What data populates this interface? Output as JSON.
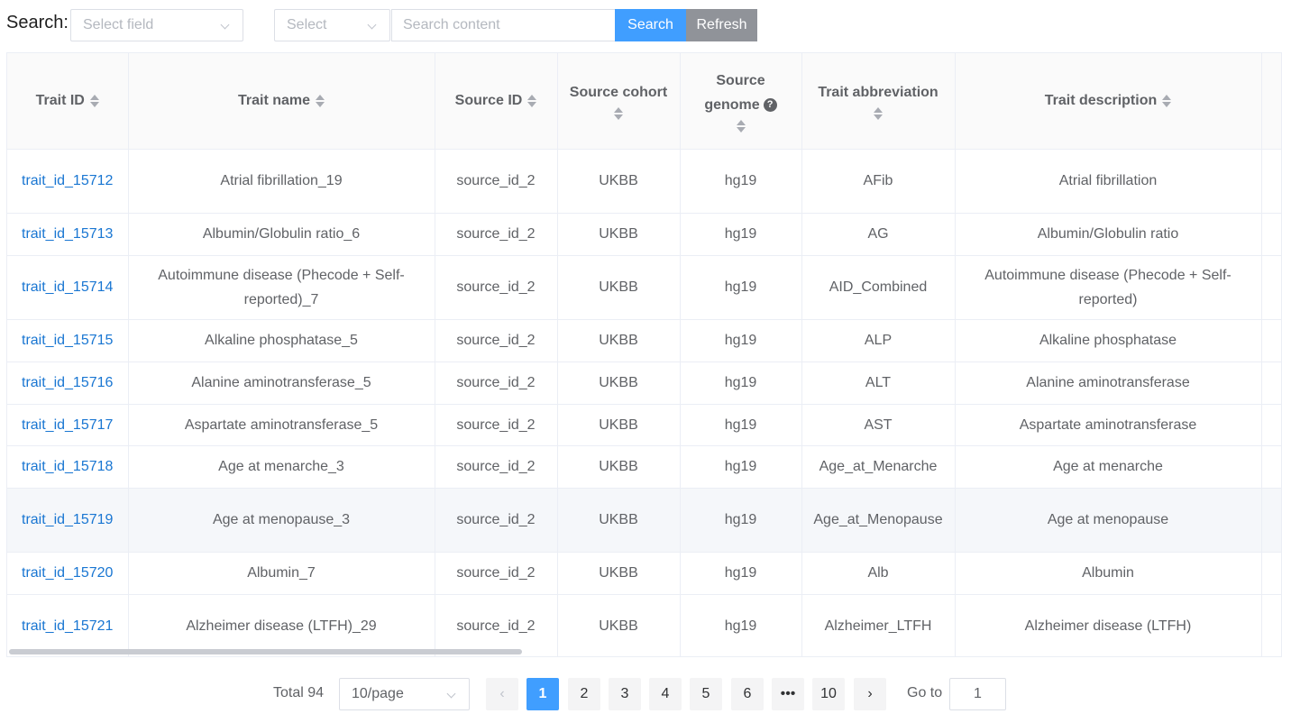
{
  "search": {
    "label": "Search:",
    "field_placeholder": "Select field",
    "operator_placeholder": "Select",
    "content_placeholder": "Search content",
    "search_button": "Search",
    "refresh_button": "Refresh"
  },
  "table": {
    "columns": [
      {
        "label": "Trait ID"
      },
      {
        "label": "Trait name"
      },
      {
        "label": "Source ID"
      },
      {
        "label": "Source cohort"
      },
      {
        "label": "Source genome",
        "line1": "Source",
        "line2": "genome",
        "help_icon": "?"
      },
      {
        "label": "Trait abbreviation"
      },
      {
        "label": "Trait description"
      }
    ],
    "rows": [
      {
        "trait_id": "trait_id_15712",
        "trait_name": "Atrial fibrillation_19",
        "source_id": "source_id_2",
        "cohort": "UKBB",
        "genome": "hg19",
        "abbreviation": "AFib",
        "description": "Atrial fibrillation"
      },
      {
        "trait_id": "trait_id_15713",
        "trait_name": "Albumin/Globulin ratio_6",
        "source_id": "source_id_2",
        "cohort": "UKBB",
        "genome": "hg19",
        "abbreviation": "AG",
        "description": "Albumin/Globulin ratio"
      },
      {
        "trait_id": "trait_id_15714",
        "trait_name": "Autoimmune disease (Phecode + Self-reported)_7",
        "source_id": "source_id_2",
        "cohort": "UKBB",
        "genome": "hg19",
        "abbreviation": "AID_Combined",
        "description": "Autoimmune disease (Phecode + Self-reported)"
      },
      {
        "trait_id": "trait_id_15715",
        "trait_name": "Alkaline phosphatase_5",
        "source_id": "source_id_2",
        "cohort": "UKBB",
        "genome": "hg19",
        "abbreviation": "ALP",
        "description": "Alkaline phosphatase"
      },
      {
        "trait_id": "trait_id_15716",
        "trait_name": "Alanine aminotransferase_5",
        "source_id": "source_id_2",
        "cohort": "UKBB",
        "genome": "hg19",
        "abbreviation": "ALT",
        "description": "Alanine aminotransferase"
      },
      {
        "trait_id": "trait_id_15717",
        "trait_name": "Aspartate aminotransferase_5",
        "source_id": "source_id_2",
        "cohort": "UKBB",
        "genome": "hg19",
        "abbreviation": "AST",
        "description": "Aspartate aminotransferase"
      },
      {
        "trait_id": "trait_id_15718",
        "trait_name": "Age at menarche_3",
        "source_id": "source_id_2",
        "cohort": "UKBB",
        "genome": "hg19",
        "abbreviation": "Age_at_Menarche",
        "description": "Age at menarche"
      },
      {
        "trait_id": "trait_id_15719",
        "trait_name": "Age at menopause_3",
        "source_id": "source_id_2",
        "cohort": "UKBB",
        "genome": "hg19",
        "abbreviation": "Age_at_Menopause",
        "description": "Age at menopause"
      },
      {
        "trait_id": "trait_id_15720",
        "trait_name": "Albumin_7",
        "source_id": "source_id_2",
        "cohort": "UKBB",
        "genome": "hg19",
        "abbreviation": "Alb",
        "description": "Albumin"
      },
      {
        "trait_id": "trait_id_15721",
        "trait_name": "Alzheimer disease (LTFH)_29",
        "source_id": "source_id_2",
        "cohort": "UKBB",
        "genome": "hg19",
        "abbreviation": "Alzheimer_LTFH",
        "description": "Alzheimer disease (LTFH)"
      }
    ]
  },
  "pagination": {
    "total": "Total 94",
    "page_size": "10/page",
    "pages": [
      "1",
      "2",
      "3",
      "4",
      "5",
      "6",
      "•••",
      "10"
    ],
    "current_page": "1",
    "prev_icon": "‹",
    "next_icon": "›",
    "goto_label": "Go to",
    "goto_value": "1"
  },
  "colors": {
    "primary": "#409eff",
    "refresh": "#909399",
    "link": "#1976d2"
  }
}
